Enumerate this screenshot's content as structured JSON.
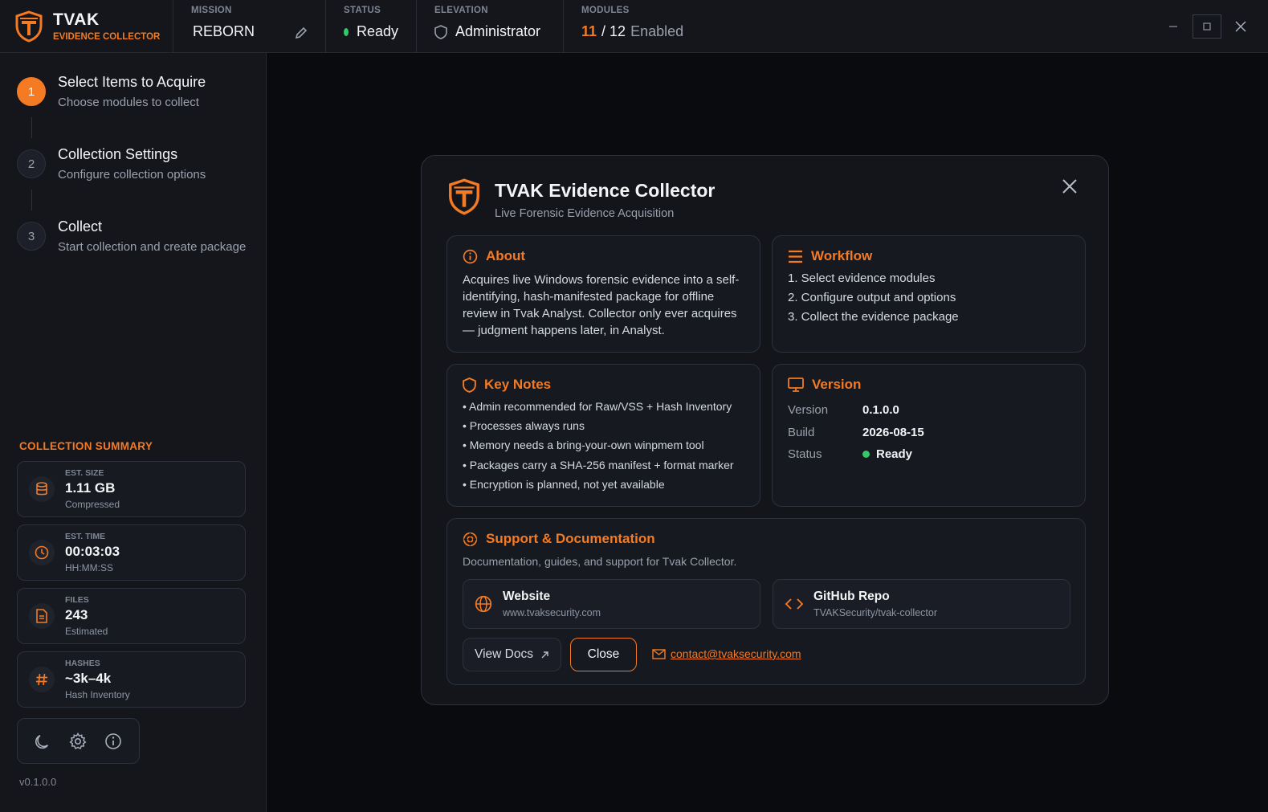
{
  "app": {
    "name": "TVAK",
    "subtitle": "EVIDENCE COLLECTOR"
  },
  "topbar": {
    "mission": {
      "label": "MISSION",
      "value": "REBORN"
    },
    "status": {
      "label": "STATUS",
      "value": "Ready"
    },
    "elevation": {
      "label": "ELEVATION",
      "value": "Administrator"
    },
    "modules": {
      "label": "MODULES",
      "enabled": "11",
      "total": "/ 12",
      "suffix": "Enabled"
    }
  },
  "steps": [
    {
      "num": "1",
      "title": "Select Items to Acquire",
      "sub": "Choose modules to collect"
    },
    {
      "num": "2",
      "title": "Collection Settings",
      "sub": "Configure collection options"
    },
    {
      "num": "3",
      "title": "Collect",
      "sub": "Start collection and create package"
    }
  ],
  "summary": {
    "title": "COLLECTION SUMMARY",
    "cards": [
      {
        "label": "EST. SIZE",
        "value": "1.11 GB",
        "sub": "Compressed"
      },
      {
        "label": "EST. TIME",
        "value": "00:03:03",
        "sub": "HH:MM:SS"
      },
      {
        "label": "FILES",
        "value": "243",
        "sub": "Estimated"
      },
      {
        "label": "HASHES",
        "value": "~3k–4k",
        "sub": "Hash Inventory"
      }
    ]
  },
  "sidebar_version": "v0.1.0.0",
  "modal": {
    "title": "TVAK Evidence Collector",
    "subtitle": "Live Forensic Evidence Acquisition",
    "about": {
      "heading": "About",
      "l1": "Acquires live Windows forensic evidence into a self-",
      "l2": "identifying, hash-manifested package for offline",
      "l3": "review in Tvak Analyst. Collector only ever acquires",
      "l4": "— judgment happens later, in Analyst."
    },
    "workflow": {
      "heading": "Workflow",
      "items": [
        "1. Select evidence modules",
        "2. Configure output and options",
        "3. Collect the evidence package"
      ]
    },
    "notes": {
      "heading": "Key Notes",
      "items": [
        "• Admin recommended for Raw/VSS + Hash Inventory",
        "• Processes always runs",
        "• Memory needs a bring-your-own winpmem tool",
        "• Packages carry a SHA-256 manifest + format marker",
        "• Encryption is planned, not yet available"
      ]
    },
    "version": {
      "heading": "Version",
      "rows": [
        {
          "k": "Version",
          "v": "0.1.0.0"
        },
        {
          "k": "Build",
          "v": "2026-08-15"
        },
        {
          "k": "Status",
          "v": "Ready"
        }
      ]
    },
    "support": {
      "heading": "Support & Documentation",
      "desc": "Documentation, guides, and support for Tvak Collector.",
      "website": {
        "title": "Website",
        "sub": "www.tvaksecurity.com"
      },
      "github": {
        "title": "GitHub Repo",
        "sub": "TVAKSecurity/tvak-collector"
      },
      "docs_button": "View Docs",
      "close_button": "Close",
      "email": "contact@tvaksecurity.com"
    }
  },
  "colors": {
    "accent": "#f47a23",
    "ready": "#35c76a",
    "bg": "#0a0b0e",
    "panel": "#14161c"
  }
}
